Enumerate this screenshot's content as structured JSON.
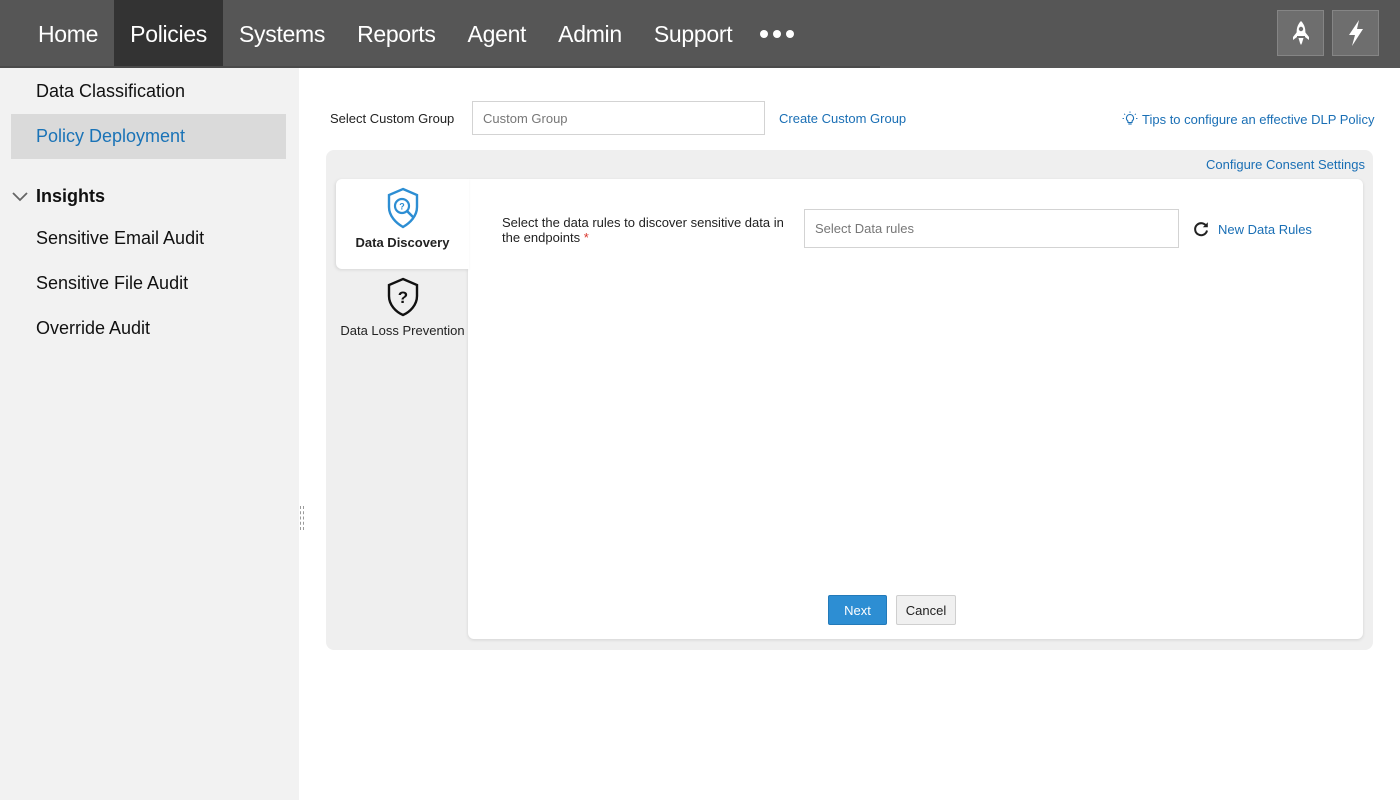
{
  "topnav": {
    "items": [
      "Home",
      "Policies",
      "Systems",
      "Reports",
      "Agent",
      "Admin",
      "Support"
    ],
    "active": "Policies",
    "more_icon": "more-dots-icon",
    "right_buttons": [
      "rocket-icon",
      "lightning-icon"
    ]
  },
  "sidebar": {
    "items": [
      "Data Classification",
      "Policy Deployment"
    ],
    "active": "Policy Deployment",
    "section": {
      "title": "Insights",
      "icon": "chevron-down-icon",
      "items": [
        "Sensitive Email Audit",
        "Sensitive File Audit",
        "Override Audit"
      ]
    }
  },
  "custom_group": {
    "label": "Select Custom Group",
    "placeholder": "Custom Group",
    "value": "",
    "create_link": "Create Custom Group"
  },
  "tips_link": "Tips to configure an effective DLP Policy",
  "consent_link": "Configure Consent Settings",
  "tabs": [
    {
      "label": "Data Discovery",
      "icon": "shield-search-icon",
      "active": true
    },
    {
      "label": "Data Loss Prevention",
      "icon": "shield-question-icon",
      "active": false
    }
  ],
  "data_rules": {
    "label": "Select the data rules to discover sensitive data in the endpoints",
    "required_mark": "*",
    "placeholder": "Select Data rules",
    "value": "",
    "new_link": "New Data Rules"
  },
  "buttons": {
    "next": "Next",
    "cancel": "Cancel"
  },
  "colors": {
    "topbar": "#565656",
    "topbar_active": "#333333",
    "accent": "#2d8ed3",
    "link": "#1a6fb5",
    "sidebar_bg": "#f2f2f2",
    "sidebar_active_bg": "#dadada",
    "required": "#d9342b"
  }
}
